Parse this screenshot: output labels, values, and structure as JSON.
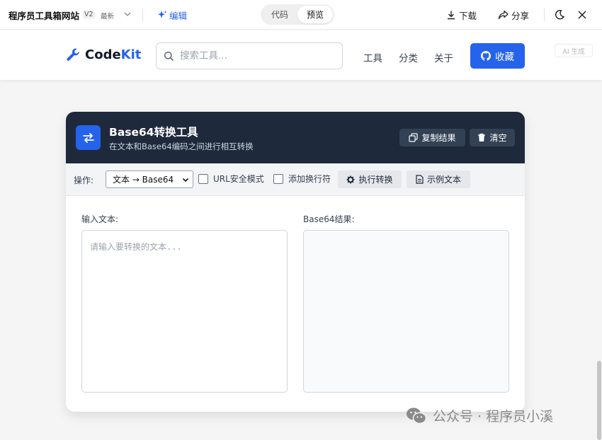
{
  "appbar": {
    "title": "程序员工具箱网站",
    "version": "V2",
    "version_tag": "最新",
    "edit_label": "编辑",
    "view_tabs": [
      "代码",
      "预览"
    ],
    "active_tab": "预览",
    "download_label": "下载",
    "share_label": "分享"
  },
  "site": {
    "logo_code": "Code",
    "logo_kit": "Kit",
    "search_placeholder": "搜索工具...",
    "nav": [
      "工具",
      "分类",
      "关于"
    ],
    "fav_label": "收藏",
    "ai_badge": "AI 生成"
  },
  "tool": {
    "title": "Base64转换工具",
    "subtitle": "在文本和Base64编码之间进行相互转换",
    "copy_label": "复制结果",
    "clear_label": "清空",
    "operation_label": "操作:",
    "operation_selected": "文本 → Base64",
    "url_safe_label": "URL安全模式",
    "newline_label": "添加换行符",
    "execute_label": "执行转换",
    "sample_label": "示例文本",
    "input_label": "输入文本:",
    "input_placeholder": "请输入要转换的文本...",
    "input_value": "",
    "output_label": "Base64结果:",
    "output_value": ""
  },
  "watermark": "公众号 · 程序员小溪",
  "colors": {
    "primary": "#2563eb",
    "card_header": "#1e293b",
    "header_button": "#334155",
    "toolbar_bg": "#f3f4f6"
  }
}
